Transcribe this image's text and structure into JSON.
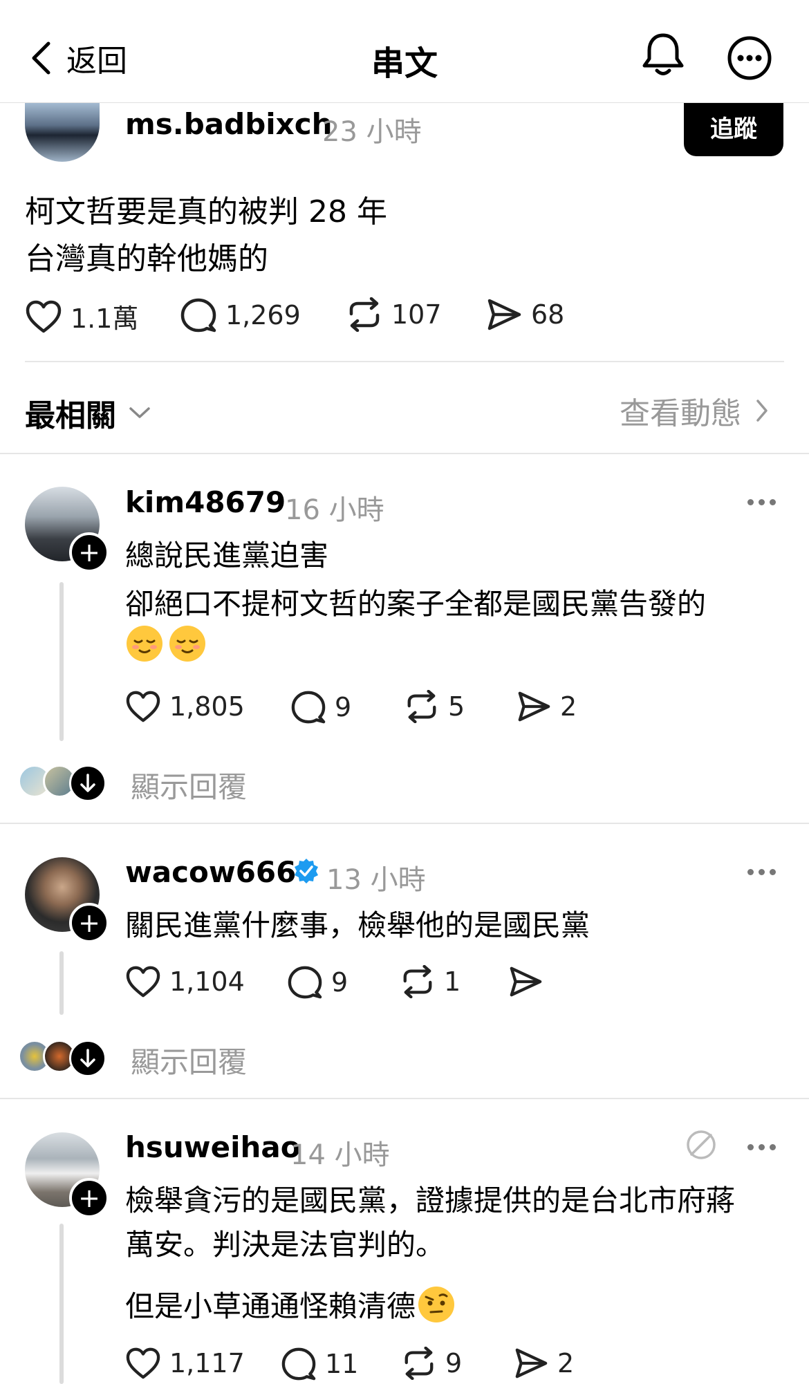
{
  "header": {
    "back_label": "返回",
    "title": "串文"
  },
  "main_post": {
    "username": "ms.badbixch",
    "time": "23 小時",
    "follow_label": "追蹤",
    "lines": [
      "柯文哲要是真的被判 28 年",
      "台灣真的幹他媽的"
    ],
    "stats": {
      "likes": "1.1萬",
      "comments": "1,269",
      "reposts": "107",
      "shares": "68"
    }
  },
  "sort_bar": {
    "sort_label": "最相關",
    "view_activity_label": "查看動態"
  },
  "replies": [
    {
      "username": "kim48679",
      "time": "16 小時",
      "verified": false,
      "lines": [
        "總說民進黨迫害",
        "卻絕口不提柯文哲的案子全都是國民黨告發的"
      ],
      "emoji": [
        "relieved-face",
        "relieved-face"
      ],
      "stats": {
        "likes": "1,805",
        "comments": "9",
        "reposts": "5",
        "shares": "2"
      },
      "show_replies": "顯示回覆"
    },
    {
      "username": "wacow666",
      "time": "13 小時",
      "verified": true,
      "lines": [
        "關民進黨什麼事，檢舉他的是國民黨"
      ],
      "stats": {
        "likes": "1,104",
        "comments": "9",
        "reposts": "1",
        "shares": ""
      },
      "show_replies": "顯示回覆"
    },
    {
      "username": "hsuweihao",
      "time": "14 小時",
      "verified": false,
      "lines": [
        "檢舉貪污的是國民黨，證據提供的是台北市府蔣",
        "萬安。判決是法官判的。",
        "但是小草通通怪賴清德"
      ],
      "emoji": [
        "face-with-raised-eyebrow"
      ],
      "stats": {
        "likes": "1,117",
        "comments": "11",
        "reposts": "9",
        "shares": "2"
      }
    }
  ],
  "colors": {
    "verified_blue": "#1d9bf0",
    "muted_text": "#999999",
    "follow_bg": "#000000"
  }
}
